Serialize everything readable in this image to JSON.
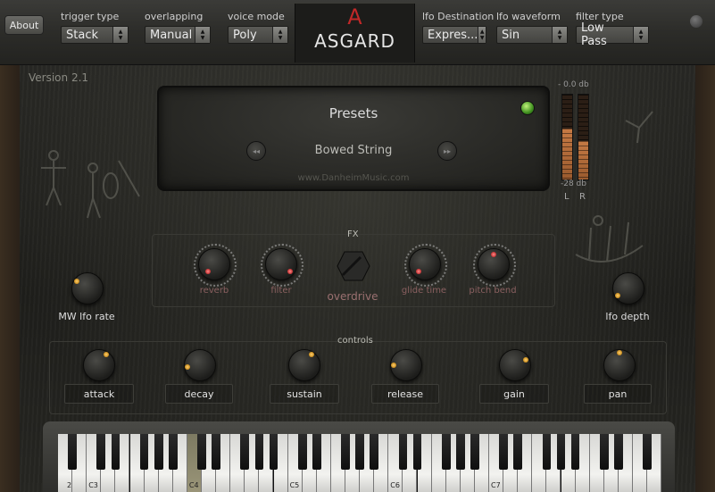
{
  "header": {
    "about_label": "About",
    "trigger_type": {
      "label": "trigger type",
      "value": "Stack"
    },
    "overlapping": {
      "label": "overlapping",
      "value": "Manual"
    },
    "voice_mode": {
      "label": "voice mode",
      "value": "Poly"
    },
    "logo_mark": "A",
    "logo_text": "ASGARD",
    "lfo_destination": {
      "label": "lfo Destination",
      "value": "Expres..."
    },
    "lfo_waveform": {
      "label": "lfo waveform",
      "value": "Sin"
    },
    "filter_type": {
      "label": "filter type",
      "value": "Low Pass"
    }
  },
  "version": "Version 2.1",
  "presets": {
    "title": "Presets",
    "current": "Bowed String",
    "url": "www.DanheimMusic.com",
    "prev_icon": "◂◂",
    "next_icon": "▸▸"
  },
  "meter": {
    "top_label": "- 0.0 db",
    "bottom_label": "-28 db",
    "left_label": "L",
    "right_label": "R",
    "left_level": 0.6,
    "right_level": 0.45
  },
  "fx": {
    "title": "FX",
    "knobs": [
      "reverb",
      "filter",
      "overdrive",
      "glide time",
      "pitch bend"
    ]
  },
  "side_knobs": {
    "mw_lfo_rate": "MW lfo rate",
    "lfo_depth": "lfo depth"
  },
  "controls": {
    "title": "controls",
    "knobs": [
      "attack",
      "decay",
      "sustain",
      "release",
      "gain",
      "pan"
    ]
  },
  "keyboard": {
    "octave_labels": [
      "2",
      "C3",
      "C4",
      "C5",
      "C6",
      "C7"
    ],
    "active_key": "C4",
    "left_arrow": "◀",
    "right_arrow": "▶"
  },
  "colors": {
    "accent_red": "#c02828",
    "led_green": "#3f8f1f",
    "knob_glow": "#ffd070",
    "fx_label": "#8a6060"
  }
}
